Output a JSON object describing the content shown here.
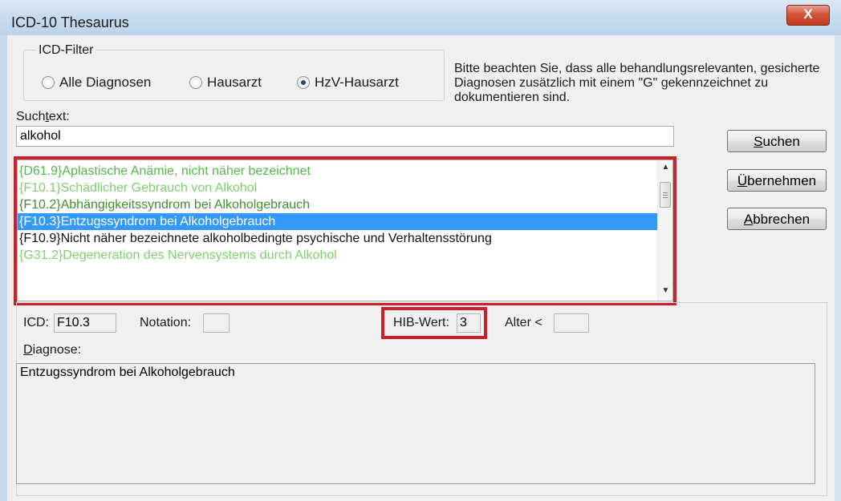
{
  "window": {
    "title": "ICD-10 Thesaurus",
    "close_glyph": "X"
  },
  "filter": {
    "group_label": "ICD-Filter",
    "options": [
      {
        "label": "Alle Diagnosen",
        "selected": false
      },
      {
        "label": "Hausarzt",
        "selected": false
      },
      {
        "label": "HzV-Hausarzt",
        "selected": true
      }
    ]
  },
  "notice": "Bitte beachten Sie, dass alle behandlungsrelevanten, gesicherte Diagnosen zusätzlich mit einem \"G\" gekennzeichnet zu dokumentieren sind.",
  "search": {
    "label_pre": "Such",
    "label_accel": "t",
    "label_post": "ext:",
    "value": "alkohol"
  },
  "buttons": {
    "suchen": {
      "accel": "S",
      "rest": "uchen"
    },
    "uebernehmen": {
      "accel": "Ü",
      "rest": "bernehmen"
    },
    "abbrechen": {
      "accel": "A",
      "rest": "bbrechen"
    }
  },
  "results": [
    {
      "text": "{D61.9}Aplastische Anämie, nicht näher bezeichnet",
      "color": "#54b84a",
      "selected": false
    },
    {
      "text": "{F10.1}Schädlicher Gebrauch von Alkohol",
      "color": "#7fd06e",
      "selected": false
    },
    {
      "text": "{F10.2}Abhängigkeitssyndrom bei Alkoholgebrauch",
      "color": "#3f8f2d",
      "selected": false
    },
    {
      "text": "{F10.3}Entzugssyndrom bei Alkoholgebrauch",
      "color": "#ffffff",
      "selected": true
    },
    {
      "text": "{F10.9}Nicht näher bezeichnete alkoholbedingte psychische und Verhaltensstörung",
      "color": "#111111",
      "selected": false
    },
    {
      "text": "{G31.2}Degeneration des Nervensystems durch Alkohol",
      "color": "#7fd06e",
      "selected": false
    }
  ],
  "details": {
    "icd_label": "ICD:",
    "icd_value": "F10.3",
    "notation_label": "Notation:",
    "notation_value": "",
    "hib_label": "HIB-Wert:",
    "hib_value": "3",
    "alter_label": "Alter <",
    "alter_value": "",
    "diagnose_accel": "D",
    "diagnose_rest": "iagnose:",
    "diagnose_text": "Entzugssyndrom bei Alkoholgebrauch"
  },
  "colors": {
    "highlight": "#cc1f2a",
    "selection": "#3399ff"
  }
}
